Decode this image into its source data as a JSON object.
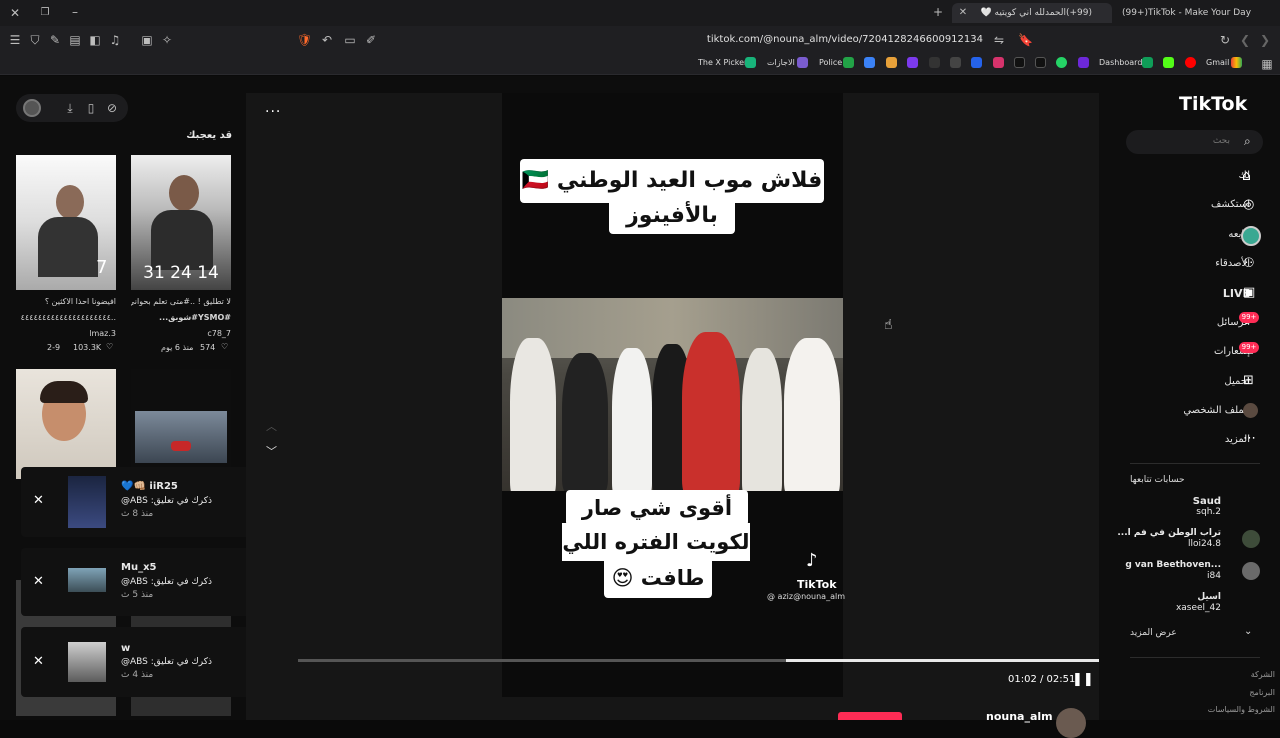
{
  "browser": {
    "tabs": [
      {
        "title": "(99+)TikTok - Make Your Day",
        "active": false
      },
      {
        "title": "(99+)الحمدلله اني كويتيه 🤍",
        "active": true
      }
    ],
    "new_tab": "+",
    "url": "tiktok.com/@nouna_alm/video/7204128246600912134",
    "bookmarks": [
      "Gmail",
      "Dashboard",
      "Police",
      "الاجازات",
      "The X Picker"
    ]
  },
  "tiktok": {
    "logo": "TikTok",
    "search_placeholder": "بحث",
    "nav": [
      {
        "label": "لك",
        "icon": "home-icon"
      },
      {
        "label": "استكشف",
        "icon": "compass-icon"
      },
      {
        "label": "أتابعه",
        "icon": "avatar-icon"
      },
      {
        "label": "الأصدقاء",
        "icon": "friends-icon"
      },
      {
        "label": "LIVE",
        "icon": "live-icon"
      },
      {
        "label": "الرسائل",
        "icon": "messages-icon",
        "badge": "99+"
      },
      {
        "label": "إشعارات",
        "icon": "inbox-icon",
        "badge": "99+"
      },
      {
        "label": "تحميل",
        "icon": "upload-icon"
      },
      {
        "label": "الملف الشخصي",
        "icon": "profile-icon"
      },
      {
        "label": "المزيد",
        "icon": "more-icon"
      }
    ],
    "following_title": "حسابات تتابعها",
    "following": [
      {
        "name": "Saud",
        "handle": "sqh.2"
      },
      {
        "name": "تراب الوطن في فم ا...",
        "handle": "lloi24.8"
      },
      {
        "name": "...g van Beethoven",
        "handle": "i84"
      },
      {
        "name": "اسيل",
        "handle": "xaseel_42"
      }
    ],
    "see_more": "عرض المزيد",
    "footer": [
      "الشركة",
      "البرنامج",
      "الشروط والسياسات"
    ]
  },
  "left_panel": {
    "title": "قد يعجبك",
    "cards": [
      {
        "desc": "لا تطليق ! ..#متى تعلم بحواني حالياً...",
        "tag": "#YSMO#شوبق...",
        "user": "c78_7",
        "likes": "574",
        "date": "منذ 6 يوم",
        "overlay": "31  24  14"
      },
      {
        "desc": "افيضونا احذا الاكثين ؟",
        "tag": "..٤٤٤٤٤٤٤٤٤٤٤٤٤٤٤٤٤٤٤٤٤",
        "user": "lmaz.3",
        "likes": "103.3K",
        "date": "2-9",
        "overlay": "7"
      }
    ]
  },
  "notifications": [
    {
      "name": "iiR25 👊🏼💙",
      "text": "ذكرك في تعليق: ABS@",
      "time": "منذ 8 ث"
    },
    {
      "name": "Mu_x5",
      "text": "ذكرك في تعليق: ABS@",
      "time": "منذ 5 ث"
    },
    {
      "name": "w",
      "text": "ذكرك في تعليق: ABS@",
      "time": "منذ 4 ث"
    }
  ],
  "video": {
    "title_line1": "فلاش موب العيد الوطني 🇰🇼",
    "title_line2": "بالأفينوز",
    "sub_line1": "أقوى شي صار حق",
    "sub_line2": "لكويت الفتره اللي",
    "sub_line3": "طافت 😍",
    "watermark": "TikTok",
    "watermark_user": "@ aziz@nouna_alm",
    "time": "01:02 / 02:51",
    "progress": 0.36,
    "author": "nouna_alm",
    "more": "..."
  }
}
